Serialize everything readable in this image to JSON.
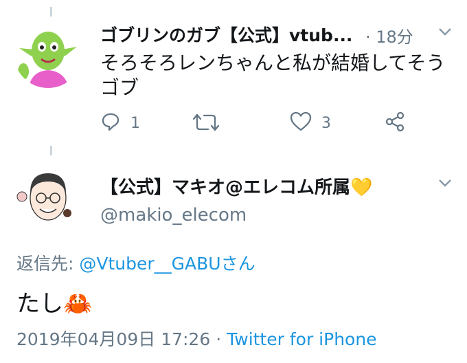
{
  "tweet1": {
    "display_name": "ゴブリンのガブ【公式】vtub...",
    "time": "· 18分",
    "text_line1": "そろそろレンちゃんと私が結婚してそう",
    "text_line2": "ゴブ",
    "reply_count": "1",
    "like_count": "3"
  },
  "tweet2": {
    "display_name": "【公式】マキオ@エレコム所属💛",
    "handle": "@makio_elecom",
    "reply_to_label": "返信先:",
    "reply_to_user": "@Vtuber__GABUさん",
    "text": "たし🦀",
    "timestamp": "2019年04月09日 17:26",
    "separator": "·",
    "source": "Twitter for iPhone"
  },
  "colors": {
    "link": "#1b95e0",
    "muted": "#657786",
    "thread": "#ccd6dd"
  },
  "icons": [
    "reply-icon",
    "retweet-icon",
    "like-icon",
    "share-icon",
    "chevron-down-icon"
  ]
}
